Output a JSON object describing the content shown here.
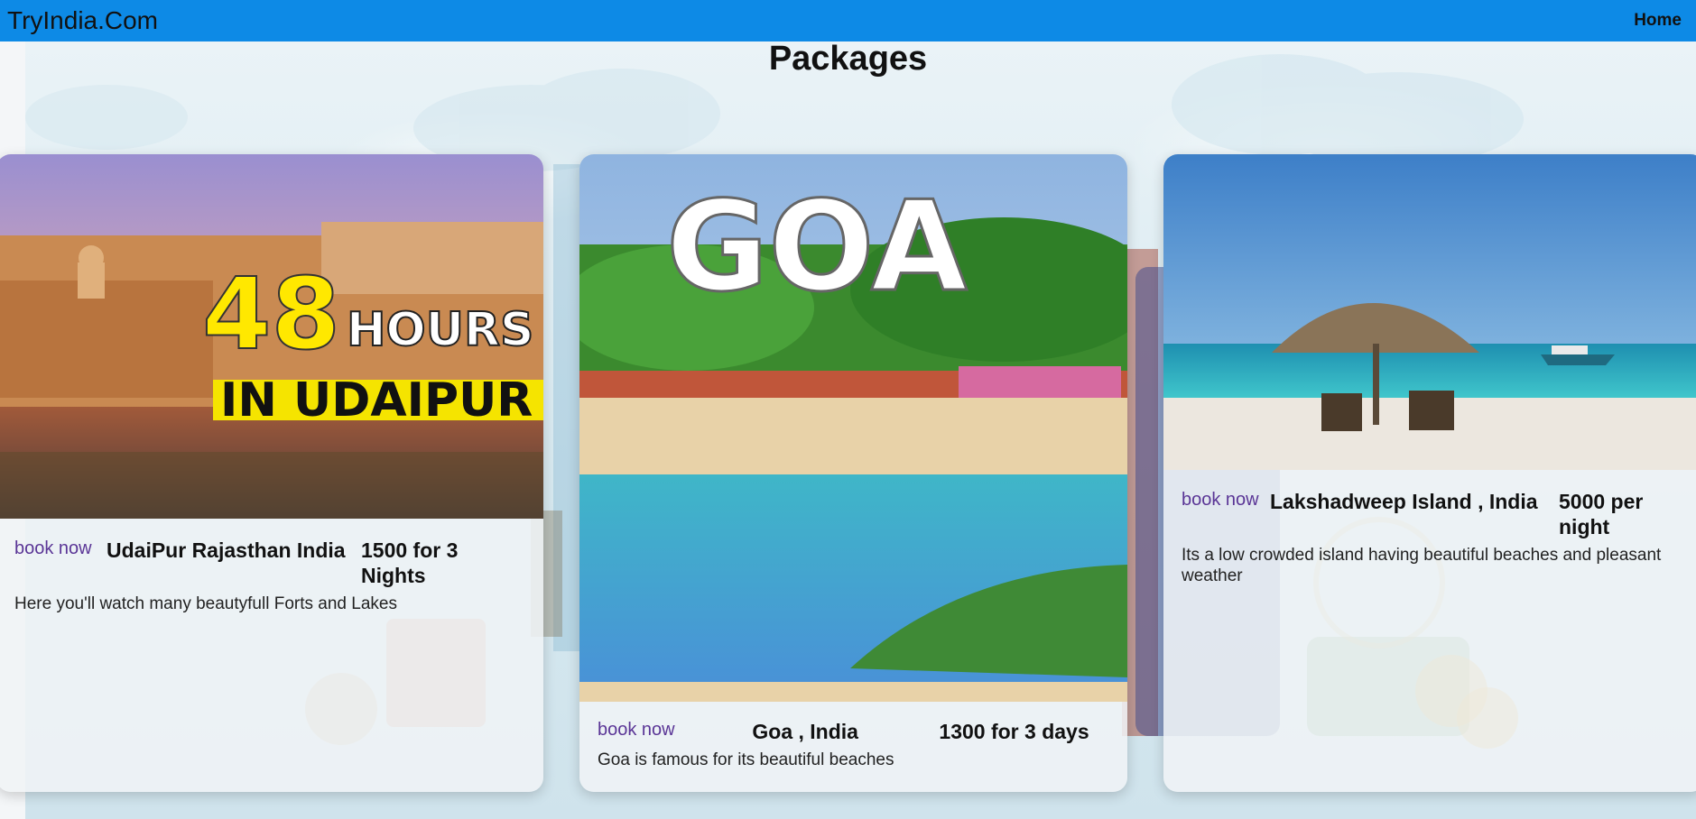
{
  "navbar": {
    "brand": "TryIndia.Com",
    "home_label": "Home"
  },
  "page": {
    "title": "Packages"
  },
  "packages": [
    {
      "book_label": "book now",
      "title": "UdaiPur Rajasthan India",
      "price": "1500 for 3 Nights",
      "description": "Here you'll watch many beautyfull Forts and Lakes",
      "image_text": {
        "big": "48",
        "word": "HOURS",
        "line2": "IN UDAIPUR"
      }
    },
    {
      "book_label": "book now",
      "title": "Goa , India",
      "price": "1300 for 3 days",
      "description": "Goa is famous for its beautiful beaches",
      "image_text": {
        "big": "GOA"
      }
    },
    {
      "book_label": "book now",
      "title": "Lakshadweep Island , India",
      "price": "5000 per night",
      "description": "Its a low crowded island having beautiful beaches and pleasant weather"
    }
  ],
  "colors": {
    "navbar": "#0d8ae6",
    "link": "#5a3596"
  }
}
